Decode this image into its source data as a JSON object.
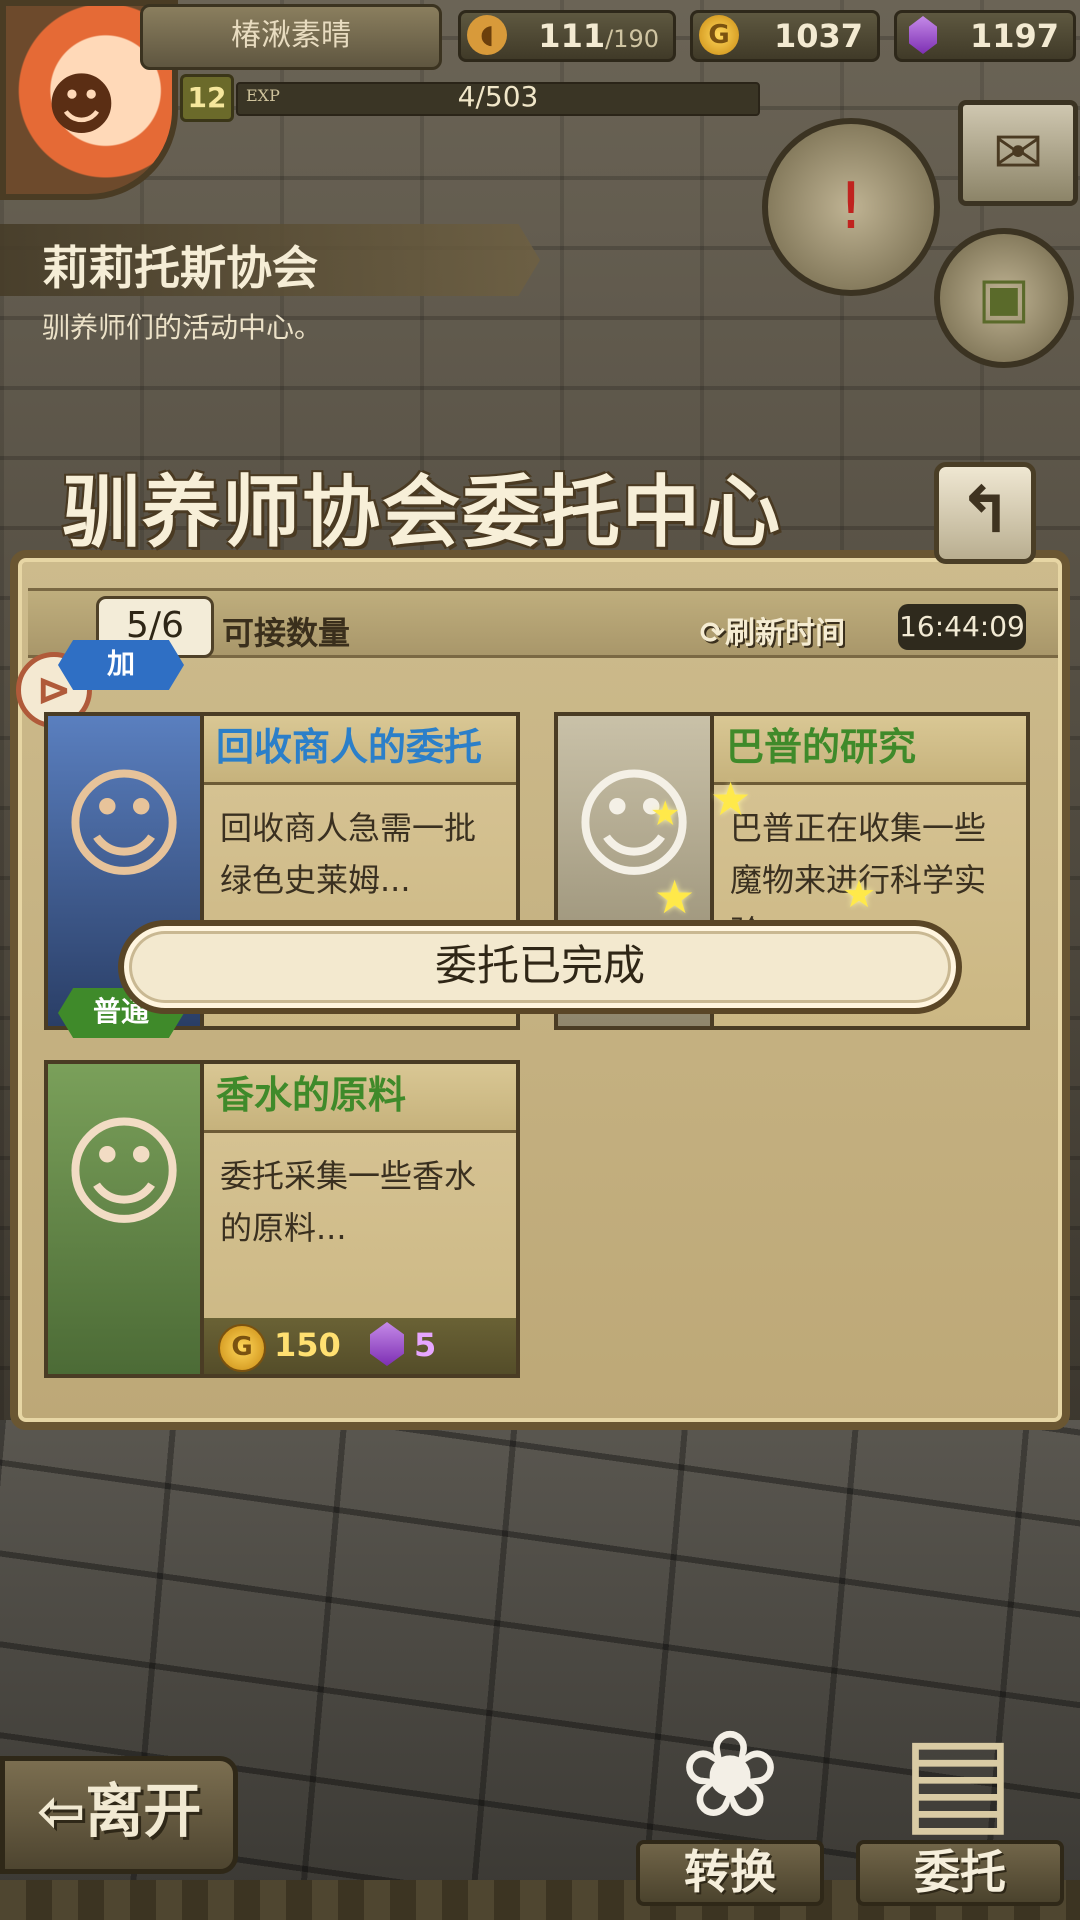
{
  "player": {
    "name": "椿湫素晴",
    "level": "12",
    "exp_label": "EXP",
    "exp_value": "4/503"
  },
  "resources": {
    "stamina": "111",
    "stamina_max": "/190",
    "gold_icon": "G",
    "gold": "1037",
    "gems": "1197"
  },
  "location": {
    "title": "莉莉托斯协会",
    "subtitle": "驯养师们的活动中心。"
  },
  "panel": {
    "title": "驯养师协会委托中心",
    "count": "5/6",
    "count_label": "可接数量",
    "refresh_label": "刷新时间",
    "refresh_time": "16:44:09"
  },
  "quests": [
    {
      "title": "回收商人的委托",
      "desc": "回收商人急需一批绿色史莱姆...",
      "tag": "加",
      "title_color": "#2b7fc9"
    },
    {
      "title": "巴普的研究",
      "desc": "巴普正在收集一些魔物来进行科学实验...",
      "title_color": "#3f8a2a"
    },
    {
      "title": "香水的原料",
      "desc": "委托采集一些香水的原料...",
      "tag": "普通",
      "reward_gold": "150",
      "reward_gems": "5",
      "title_color": "#3f8a2a"
    }
  ],
  "toast": "委托已完成",
  "nav": {
    "leave": "离开",
    "convert": "转换",
    "commission": "委托"
  },
  "icons": {
    "stamina": "bread-icon",
    "gold": "gold-coin-icon",
    "gems": "purple-gem-icon",
    "quest": "scroll-quest-icon",
    "mail": "mail-icon",
    "bag": "backpack-icon",
    "back": "back-arrow-icon",
    "refresh": "refresh-icon"
  }
}
